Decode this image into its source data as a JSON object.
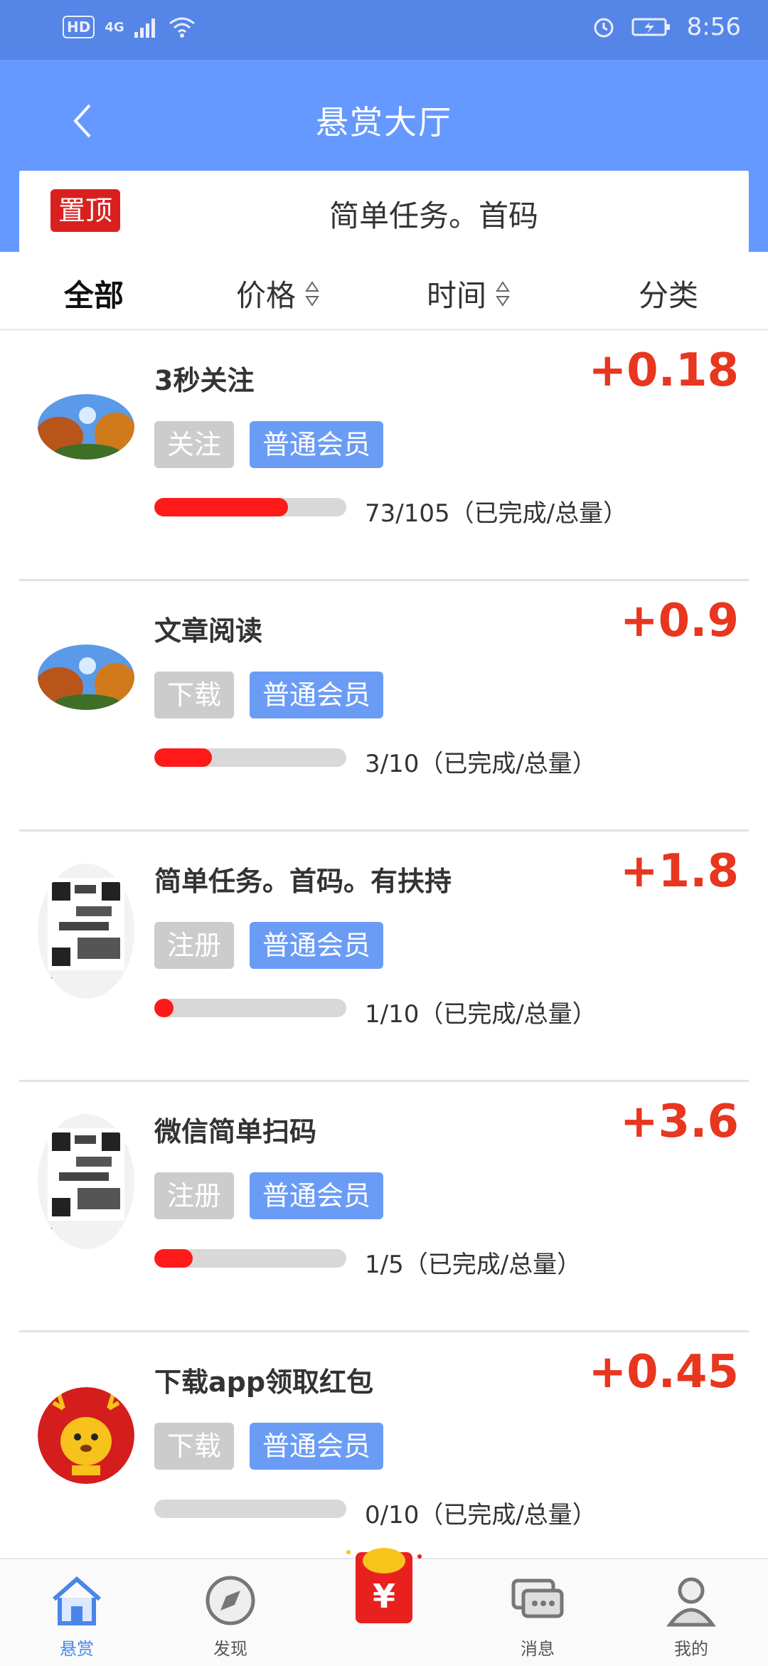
{
  "status_bar": {
    "network": "4G",
    "hd": "HD",
    "time": "8:56"
  },
  "header": {
    "title": "悬赏大厅",
    "pin_badge": "置顶",
    "pin_text": "简单任务。首码"
  },
  "filters": [
    "全部",
    "价格",
    "时间",
    "分类"
  ],
  "tasks": [
    {
      "title": "3秒关注",
      "reward": "+0.18",
      "type": "关注",
      "level": "普通会员",
      "progress": "73/105（已完成/总量）",
      "completed": 73,
      "total": 105,
      "thumb": "landscape"
    },
    {
      "title": "文章阅读",
      "reward": "+0.9",
      "type": "下载",
      "level": "普通会员",
      "progress": "3/10（已完成/总量）",
      "completed": 3,
      "total": 10,
      "thumb": "landscape"
    },
    {
      "title": "简单任务。首码。有扶持",
      "reward": "+1.8",
      "type": "注册",
      "level": "普通会员",
      "progress": "1/10（已完成/总量）",
      "completed": 1,
      "total": 10,
      "thumb": "qr"
    },
    {
      "title": "微信简单扫码",
      "reward": "+3.6",
      "type": "注册",
      "level": "普通会员",
      "progress": "1/5（已完成/总量）",
      "completed": 1,
      "total": 5,
      "thumb": "qr"
    },
    {
      "title": "下载app领取红包",
      "reward": "+0.45",
      "type": "下载",
      "level": "普通会员",
      "progress": "0/10（已完成/总量）",
      "completed": 0,
      "total": 10,
      "thumb": "deer"
    }
  ],
  "nav": [
    "悬赏",
    "发现",
    "",
    "消息",
    "我的"
  ],
  "colors": {
    "header": "#6699ff",
    "status": "#5585e6",
    "reward": "#e8361f",
    "tag_level": "#6b9cf5",
    "progress": "#ff1a1a"
  }
}
